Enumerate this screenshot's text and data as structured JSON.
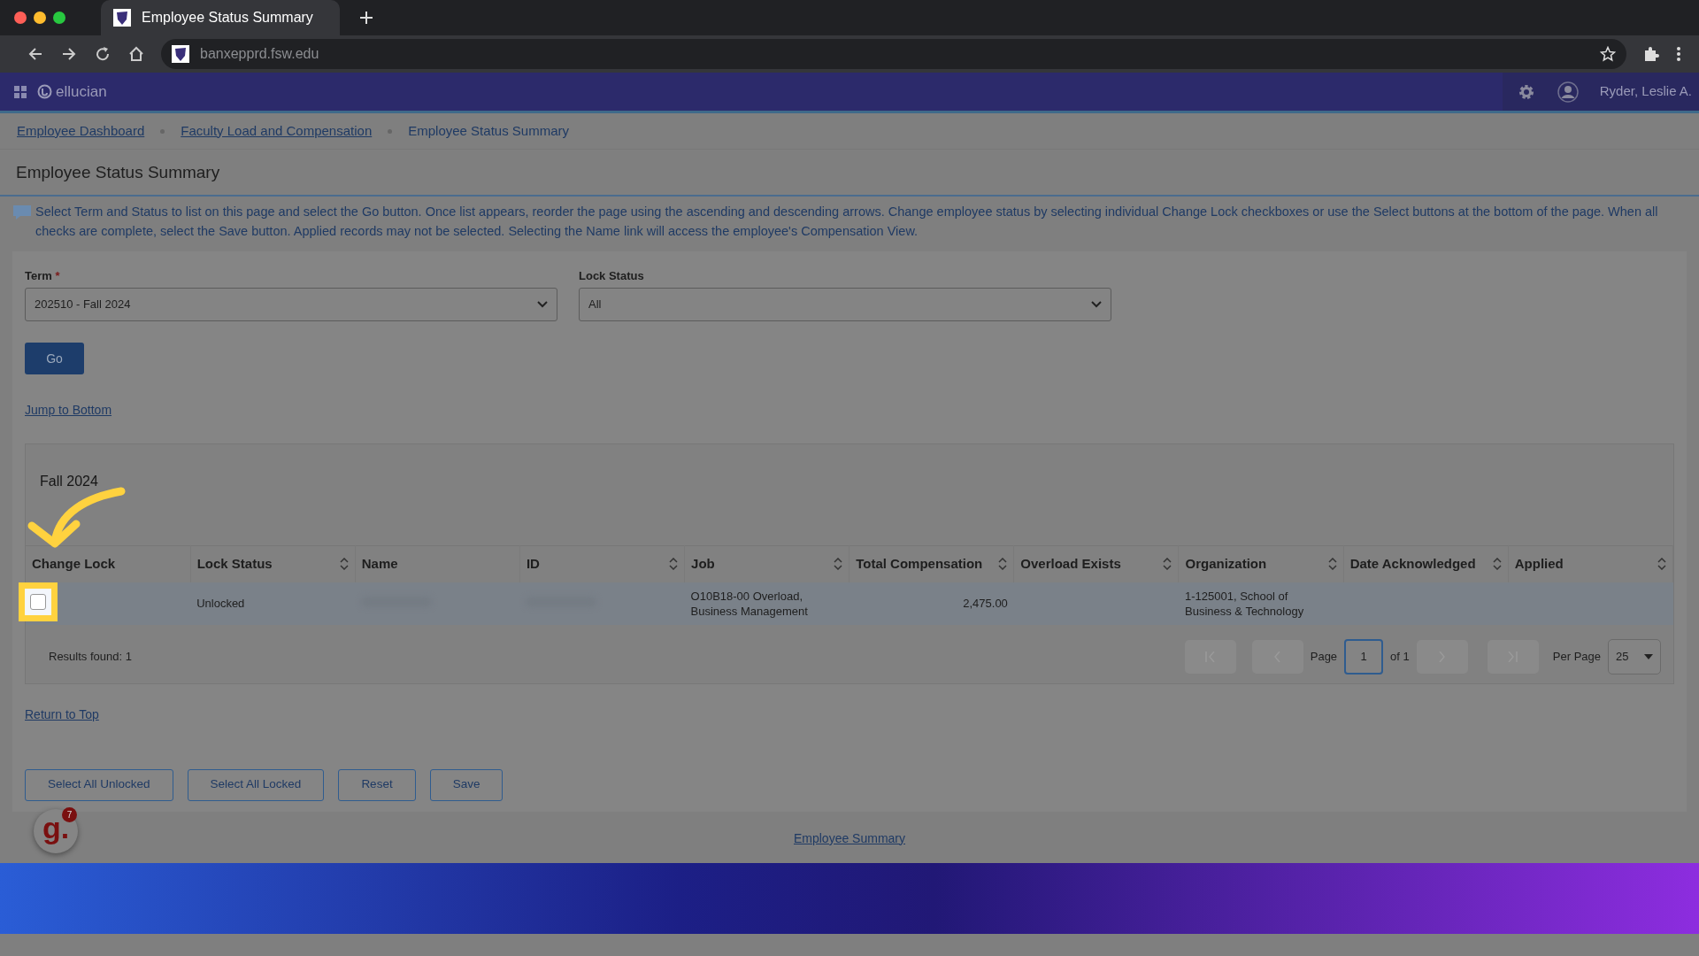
{
  "browser": {
    "tab_title": "Employee Status Summary",
    "url": "banxepprd.fsw.edu"
  },
  "app": {
    "brand": "ellucian",
    "user": "Ryder, Leslie A."
  },
  "breadcrumbs": [
    {
      "label": "Employee Dashboard",
      "link": true
    },
    {
      "label": "Faculty Load and Compensation",
      "link": true
    },
    {
      "label": "Employee Status Summary",
      "link": false
    }
  ],
  "page_title": "Employee Status Summary",
  "instructions": "Select Term and Status to list on this page and select the Go button. Once list appears, reorder the page using the ascending and descending arrows. Change employee status by selecting individual Change Lock checkboxes or use the Select buttons at the bottom of the page. When all checks are complete, select the Save button. Applied records may not be selected. Selecting the Name link will access the employee's Compensation View.",
  "form": {
    "term": {
      "label": "Term",
      "required_mark": "*",
      "value": "202510 - Fall 2024"
    },
    "lock_status": {
      "label": "Lock Status",
      "value": "All"
    },
    "go_button": "Go"
  },
  "jump_link": "Jump to Bottom",
  "table": {
    "title": "Fall 2024",
    "columns": [
      {
        "label": "Change Lock",
        "sortable": false
      },
      {
        "label": "Lock Status",
        "sortable": true
      },
      {
        "label": "Name",
        "sortable": false
      },
      {
        "label": "ID",
        "sortable": true
      },
      {
        "label": "Job",
        "sortable": true
      },
      {
        "label": "Total Compensation",
        "sortable": true
      },
      {
        "label": "Overload Exists",
        "sortable": true
      },
      {
        "label": "Organization",
        "sortable": true
      },
      {
        "label": "Date Acknowledged",
        "sortable": true
      },
      {
        "label": "Applied",
        "sortable": true
      }
    ],
    "rows": [
      {
        "checked": false,
        "lock_status": "Unlocked",
        "job": "O10B18-00 Overload, Business Management",
        "total_compensation": "2,475.00",
        "organization": "1-125001, School of Business & Technology"
      }
    ]
  },
  "results": "Results found: 1",
  "pagination": {
    "page_label": "Page",
    "page": "1",
    "of": "of 1",
    "per_page_label": "Per Page",
    "per_page": "25"
  },
  "return_link": "Return to Top",
  "buttons": [
    "Select All Unlocked",
    "Select All Locked",
    "Reset",
    "Save"
  ],
  "footer_link": "Employee Summary",
  "assistant": {
    "logo": "g.",
    "badge": "7"
  }
}
